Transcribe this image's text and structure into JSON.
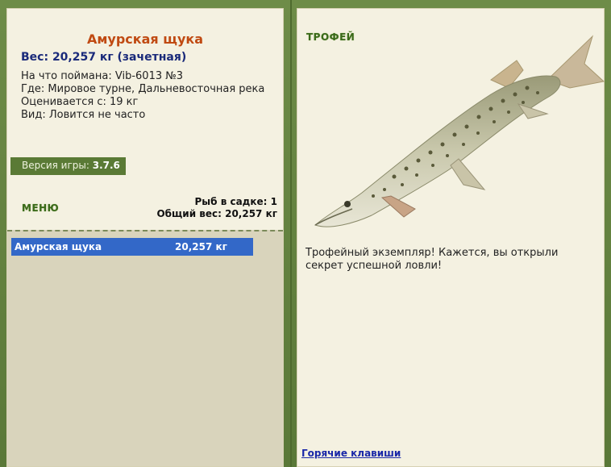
{
  "left": {
    "fish_name": "Амурская щука",
    "weight": "Вес: 20,257 кг (зачетная)",
    "bait": "На что поймана: Vib-6013 №3",
    "location": "Где: Мировое турне, Дальневосточная река",
    "rated_from": "Оценивается с: 19 кг",
    "rarity": "Вид: Ловится не часто",
    "version_label": "Версия игры: ",
    "version_value": "3.7.6",
    "menu_label": "МЕНЮ",
    "fish_in_net": "Рыб в садке: 1",
    "total_weight": "Общий вес: 20,257 кг",
    "catch_list": [
      {
        "name": "Амурская щука",
        "weight": "20,257 кг"
      }
    ]
  },
  "right": {
    "trophy_label": "ТРОФЕЙ",
    "trophy_text": "Трофейный экземпляр! Кажется, вы открыли секрет успешной ловли!",
    "hotkeys_link": "Горячие клавиши"
  },
  "colors": {
    "background": "#4e6a2e",
    "panel": "#f4f1e1",
    "fish_name": "#c04a12",
    "weight": "#1a2a7a",
    "selection": "#3368c8",
    "menu_text": "#3a6a1a"
  },
  "icons": {
    "fish_image": "amur-pike-fish-icon"
  }
}
